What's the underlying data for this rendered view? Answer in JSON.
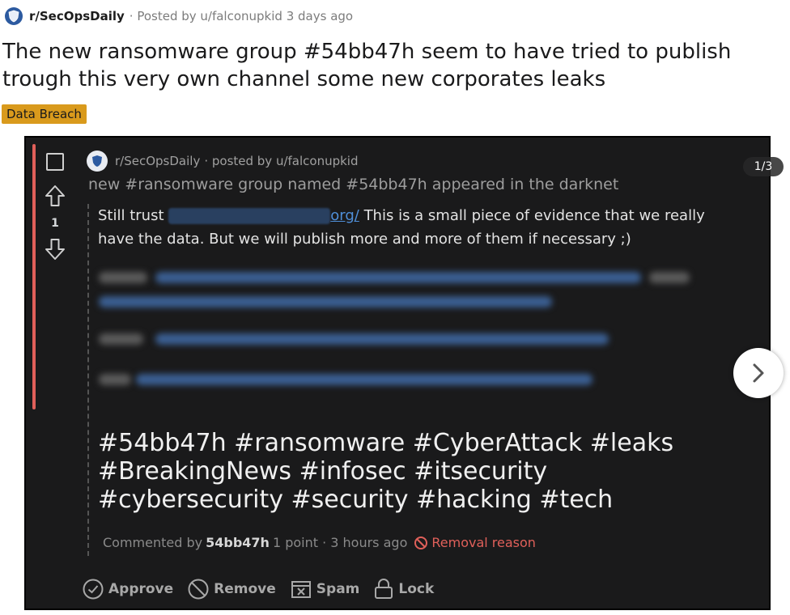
{
  "post": {
    "subreddit": "r/SecOpsDaily",
    "posted_by_prefix": "· Posted by u/falconupkid",
    "age": "3 days ago",
    "title": "The new ransomware group #54bb47h seem to have tried to publish trough this very own channel some new corporates leaks",
    "flair": "Data Breach"
  },
  "gallery": {
    "counter": "1/3"
  },
  "screenshot": {
    "header_sub": "r/SecOpsDaily",
    "header_meta": "· posted by u/falconupkid",
    "vote_count": "1",
    "title": "new #ransomware group named #54bb47h appeared in the darknet",
    "comment_before": "Still trust",
    "comment_link": "org/",
    "comment_after": " This is a small piece of evidence that we really have the data. But we will publish more and more of them if necessary ;)",
    "hashtags": "#54bb47h #ransomware #CyberAttack #leaks #BreakingNews #infosec #itsecurity #cybersecurity #security #hacking #tech",
    "comment_meta_prefix": "Commented by",
    "comment_author": "54bb47h",
    "comment_stats": "1 point · 3 hours ago",
    "removal_reason": "Removal reason",
    "actions": {
      "approve": "Approve",
      "remove": "Remove",
      "spam": "Spam",
      "lock": "Lock"
    }
  },
  "colors": {
    "flair_bg": "#d99a1c",
    "accent_red": "#e0605a",
    "link_blue": "#4f8fd9",
    "dark_bg": "#1a1a1b"
  }
}
